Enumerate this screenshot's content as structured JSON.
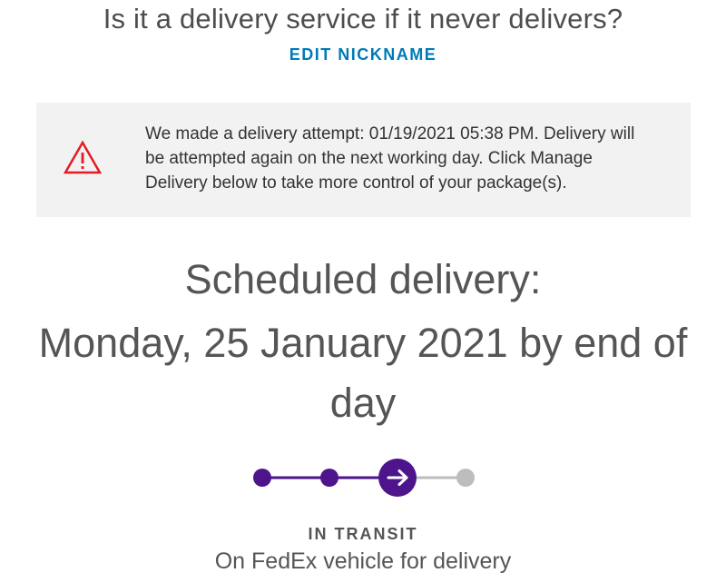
{
  "header": {
    "nickname": "Is it a delivery service if it never delivers?",
    "edit_nickname_label": "EDIT NICKNAME"
  },
  "alert": {
    "icon": "warning-triangle-icon",
    "icon_color": "#e31b23",
    "message": "We made a delivery attempt: 01/19/2021 05:38 PM. Delivery will be attempted again on the next working day. Click Manage Delivery below to take more control of your package(s)."
  },
  "delivery": {
    "scheduled_label": "Scheduled delivery:",
    "scheduled_date": "Monday, 25 January 2021 by end of day"
  },
  "progress": {
    "total_steps": 4,
    "current_step": 3,
    "active_color": "#4d148c",
    "inactive_color": "#bdbdbd",
    "current_icon": "arrow-right-icon"
  },
  "status": {
    "title": "IN TRANSIT",
    "detail": "On FedEx vehicle for delivery"
  }
}
